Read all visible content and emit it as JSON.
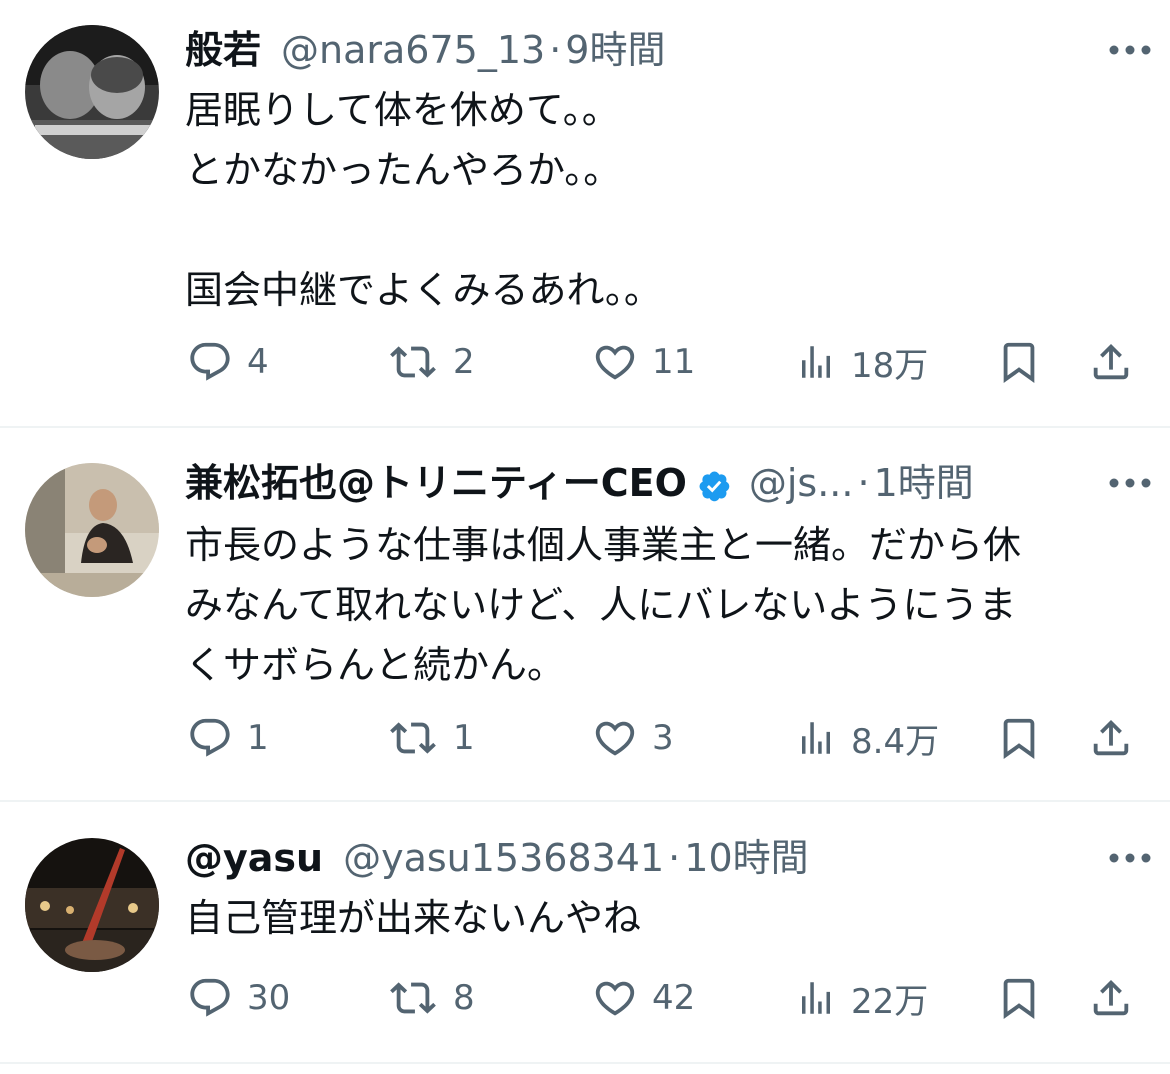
{
  "colors": {
    "text": "#0f1419",
    "secondary": "#536471",
    "verified": "#1d9bf0",
    "divider": "#eff3f4"
  },
  "tweets": [
    {
      "name": "般若",
      "handle": "@nara675_13",
      "separator": "·",
      "time": "9時間",
      "lines": [
        "居眠りして体を休めて。。",
        "とかなかったんやろか。。",
        "",
        "国会中継でよくみるあれ。。"
      ],
      "stats": {
        "replies": "4",
        "retweets": "2",
        "likes": "11",
        "views": "18万"
      }
    },
    {
      "name": "兼松拓也@トリニティーCEO",
      "verified": true,
      "handle": "@js...",
      "separator": "·",
      "time": "1時間",
      "lines": [
        "市長のような仕事は個人事業主と一緒。だから休",
        "みなんて取れないけど、人にバレないようにうま",
        "くサボらんと続かん。"
      ],
      "stats": {
        "replies": "1",
        "retweets": "1",
        "likes": "3",
        "views": "8.4万"
      }
    },
    {
      "name": "@yasu",
      "handle": "@yasu15368341",
      "separator": "·",
      "time": "10時間",
      "lines": [
        "自己管理が出来ないんやね"
      ],
      "stats": {
        "replies": "30",
        "retweets": "8",
        "likes": "42",
        "views": "22万"
      }
    }
  ],
  "icons": [
    "more-icon",
    "verified-icon",
    "reply-icon",
    "retweet-icon",
    "like-icon",
    "views-icon",
    "bookmark-icon",
    "share-icon"
  ]
}
